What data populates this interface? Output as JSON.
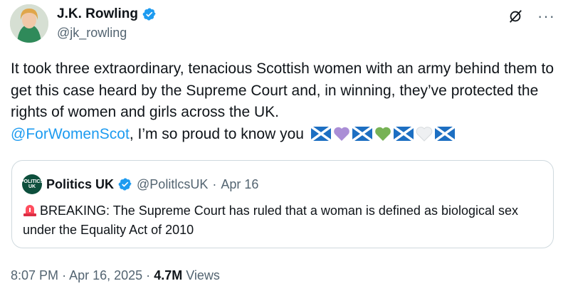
{
  "author": {
    "name": "J.K. Rowling",
    "handle": "@jk_rowling"
  },
  "tweet": {
    "text": "It took three extraordinary, tenacious Scottish women with an army behind them to get this case heard by the Supreme Court and, in winning, they’ve protected the rights of women and girls across the UK.",
    "mention": "@ForWomenScot",
    "text_after_mention": ", I’m so proud to know you"
  },
  "quote": {
    "avatar_text": "POLITICS UK",
    "name": "Politics UK",
    "handle": "@PolitlcsUK",
    "separator": "·",
    "date": "Apr 16",
    "text": "BREAKING: The Supreme Court has ruled that a woman is defined as biological sex under the Equality Act of 2010"
  },
  "meta": {
    "time": "8:07 PM",
    "separator1": "·",
    "date": "Apr 16, 2025",
    "separator2": "·",
    "views_count": "4.7M",
    "views_label": "Views"
  },
  "icons": {
    "verified": "verified-badge-icon",
    "grok": "grok-icon",
    "more": "more-options-icon",
    "siren": "siren-emoji-icon"
  },
  "colors": {
    "accent": "#1d9bf0",
    "text": "#0f1419",
    "muted": "#536471",
    "border": "#cfd9de"
  }
}
